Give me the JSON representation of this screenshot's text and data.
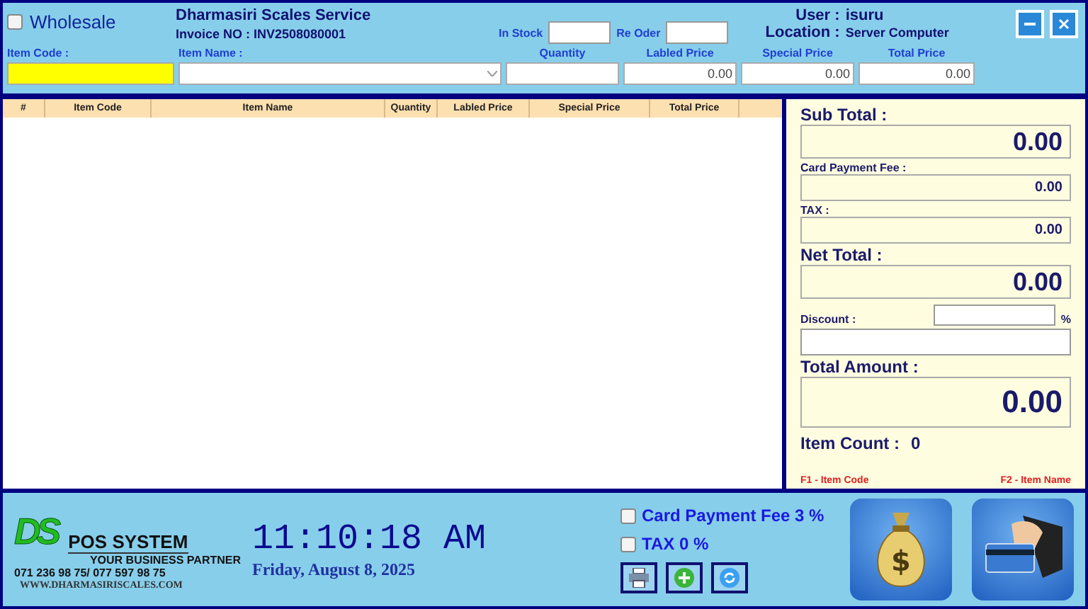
{
  "wholesale": {
    "label": "Wholesale",
    "checked": false
  },
  "company": {
    "name": "Dharmasiri Scales Service",
    "invoice": "Invoice NO : INV2508080001"
  },
  "stock_fields": [
    {
      "label": "In Stock"
    },
    {
      "label": "Re Oder"
    }
  ],
  "user": {
    "label": "User :",
    "value": "isuru"
  },
  "location": {
    "label": "Location :",
    "value": "Server Computer"
  },
  "window_buttons": [
    {
      "kind": "minimize"
    },
    {
      "kind": "close"
    }
  ],
  "entry_fields": [
    {
      "label": "Item Code :",
      "kind": "code"
    },
    {
      "label": "Item Name :",
      "kind": "select"
    },
    {
      "label": "Quantity",
      "kind": "text"
    },
    {
      "label": "Labled Price",
      "kind": "number",
      "value": "0.00"
    },
    {
      "label": "Special Price",
      "kind": "number",
      "value": "0.00"
    },
    {
      "label": "Total Price",
      "kind": "number",
      "value": "0.00"
    }
  ],
  "table": {
    "columns": [
      "#",
      "Item Code",
      "Item Name",
      "Quantity",
      "Labled Price",
      "Special Price",
      "Total Price"
    ]
  },
  "summary": [
    {
      "label": "Sub Total :",
      "kind": "big",
      "value": "0.00"
    },
    {
      "label": "Card Payment Fee :",
      "kind": "small",
      "value": "0.00"
    },
    {
      "label": "TAX :",
      "kind": "small",
      "value": "0.00"
    },
    {
      "label": "Net Total :",
      "kind": "big",
      "value": "0.00"
    },
    {
      "label": "Discount :",
      "kind": "discount",
      "unit": "%"
    },
    {
      "label": "Total Amount :",
      "kind": "total",
      "value": "0.00"
    }
  ],
  "item_count": {
    "label": "Item Count :",
    "value": "0"
  },
  "shortcuts": [
    "F1 - Item Code",
    "F2 - Item Name"
  ],
  "brand": {
    "logo": "DS",
    "name": "POS SYSTEM",
    "tagline": "YOUR BUSINESS PARTNER",
    "phone": "071 236 98 75/ 077 597 98 75",
    "website": "WWW.DHARMASIRISCALES.COM"
  },
  "clock": {
    "time": "11:10:18 AM",
    "date": "Friday, August 8, 2025"
  },
  "options": [
    {
      "label": "Card Payment Fee 3 %",
      "checked": false
    },
    {
      "label": "TAX 0 %",
      "checked": false
    }
  ],
  "tool_buttons": [
    {
      "kind": "print"
    },
    {
      "kind": "add"
    },
    {
      "kind": "refresh"
    }
  ],
  "action_buttons": [
    {
      "kind": "cash",
      "symbol": "$"
    },
    {
      "kind": "card"
    }
  ]
}
